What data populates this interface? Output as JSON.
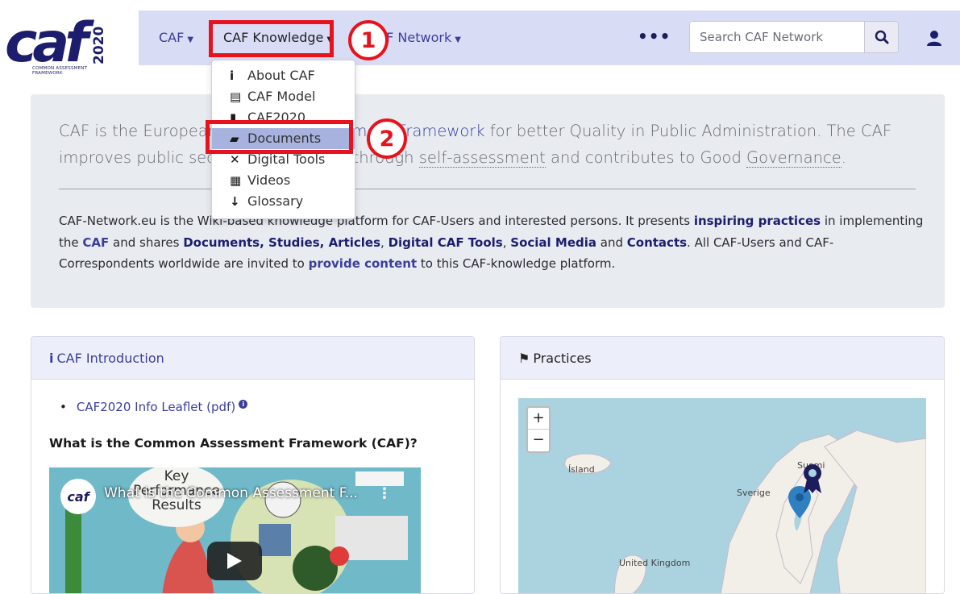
{
  "logo": {
    "text": "caf",
    "year": "2020",
    "tagline": "COMMON ASSESSMENT FRAMEWORK"
  },
  "nav": {
    "items": [
      {
        "label": "CAF"
      },
      {
        "label": "CAF Knowledge"
      },
      {
        "label": "CAF Network"
      }
    ],
    "more_label": "•••",
    "search_placeholder": "Search CAF Network"
  },
  "annotations": {
    "step1": "1",
    "step2": "2"
  },
  "dropdown": {
    "items": [
      {
        "label": "About CAF",
        "icon": "info-icon"
      },
      {
        "label": "CAF Model",
        "icon": "clipboard-icon"
      },
      {
        "label": "CAF2020",
        "icon": "book-icon"
      },
      {
        "label": "Documents",
        "icon": "pdf-file-icon"
      },
      {
        "label": "Digital Tools",
        "icon": "tools-icon"
      },
      {
        "label": "Videos",
        "icon": "film-icon"
      },
      {
        "label": "Glossary",
        "icon": "sort-icon"
      }
    ]
  },
  "hero": {
    "lead_1": "CAF is the European ",
    "lead_link": "Common Assessment Framework",
    "lead_2": " for better Quality in Public Administration. The CAF improves public sector organisations through ",
    "lead_3": "self-assessment",
    "lead_4": " and contributes to Good ",
    "lead_5": "Governance",
    "lead_6": ".",
    "p_1": "CAF-Network.eu is the Wiki-based knowledge platform for CAF-Users and interested persons. It presents ",
    "p_inspiring": "inspiring practices",
    "p_2": " in implementing the ",
    "p_caf": "CAF",
    "p_3": " and shares ",
    "p_docs": "Documents, Studies, Articles",
    "p_4": ", ",
    "p_tools": "Digital CAF Tools",
    "p_5": ", ",
    "p_social": "Social Media",
    "p_6": " and ",
    "p_contacts": "Contacts",
    "p_7": ". All CAF-Users and CAF-Correspondents worldwide are invited to ",
    "p_provide": "provide content",
    "p_8": " to this CAF-knowledge platform."
  },
  "intro": {
    "title": "CAF Introduction",
    "link": "CAF2020 Info Leaflet (pdf)",
    "heading": "What is the Common Assessment Framework (CAF)?",
    "video_title": "What is the Common Assessment F...",
    "video_bubble": "Key Performance Results"
  },
  "practices": {
    "title": "Practices",
    "zoom_in": "+",
    "zoom_out": "−",
    "labels": {
      "iceland": "Ísland",
      "sweden": "Sverige",
      "uk": "United Kingdom",
      "finland": "Suomi"
    }
  }
}
